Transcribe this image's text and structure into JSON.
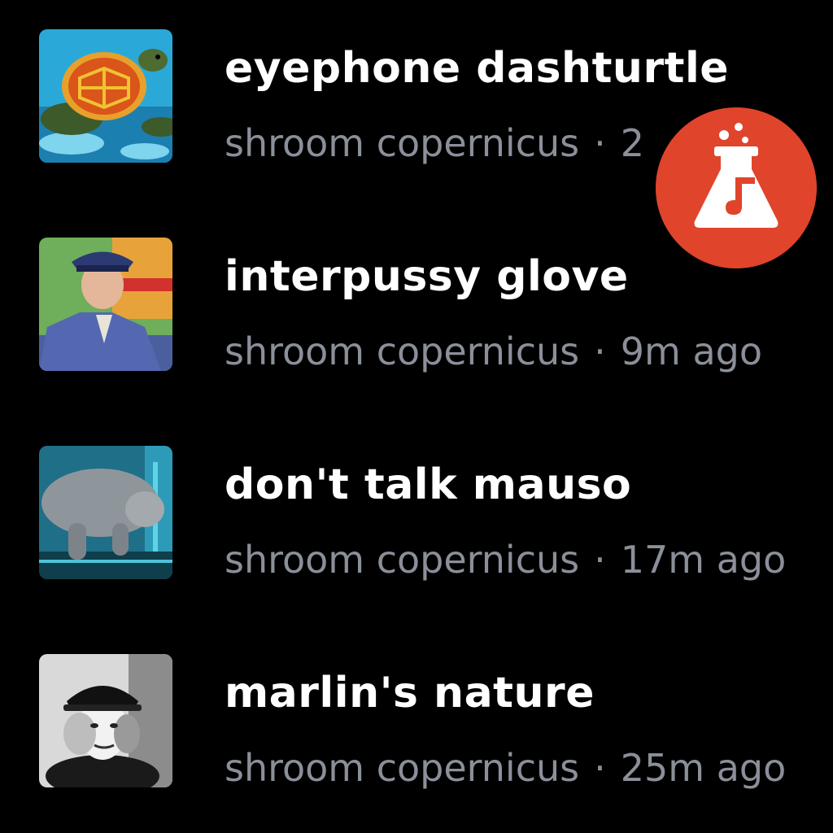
{
  "tracks": [
    {
      "title": "eyephone dashturtle",
      "artist": "shroom copernicus",
      "separator": "·",
      "time": "2",
      "thumb_icon": "sea-turtle-artwork"
    },
    {
      "title": "interpussy glove",
      "artist": "shroom copernicus",
      "separator": "·",
      "time": "9m ago",
      "thumb_icon": "police-officer-artwork"
    },
    {
      "title": "don't talk mauso",
      "artist": "shroom copernicus",
      "separator": "·",
      "time": "17m ago",
      "thumb_icon": "manatee-artwork"
    },
    {
      "title": "marlin's nature",
      "artist": "shroom copernicus",
      "separator": "·",
      "time": "25m ago",
      "thumb_icon": "woman-hat-portrait-artwork"
    }
  ],
  "badge": {
    "icon": "flask-music-note-icon",
    "color": "#e0442b"
  },
  "colors": {
    "background": "#000000",
    "title": "#ffffff",
    "meta": "#8a8f99"
  }
}
